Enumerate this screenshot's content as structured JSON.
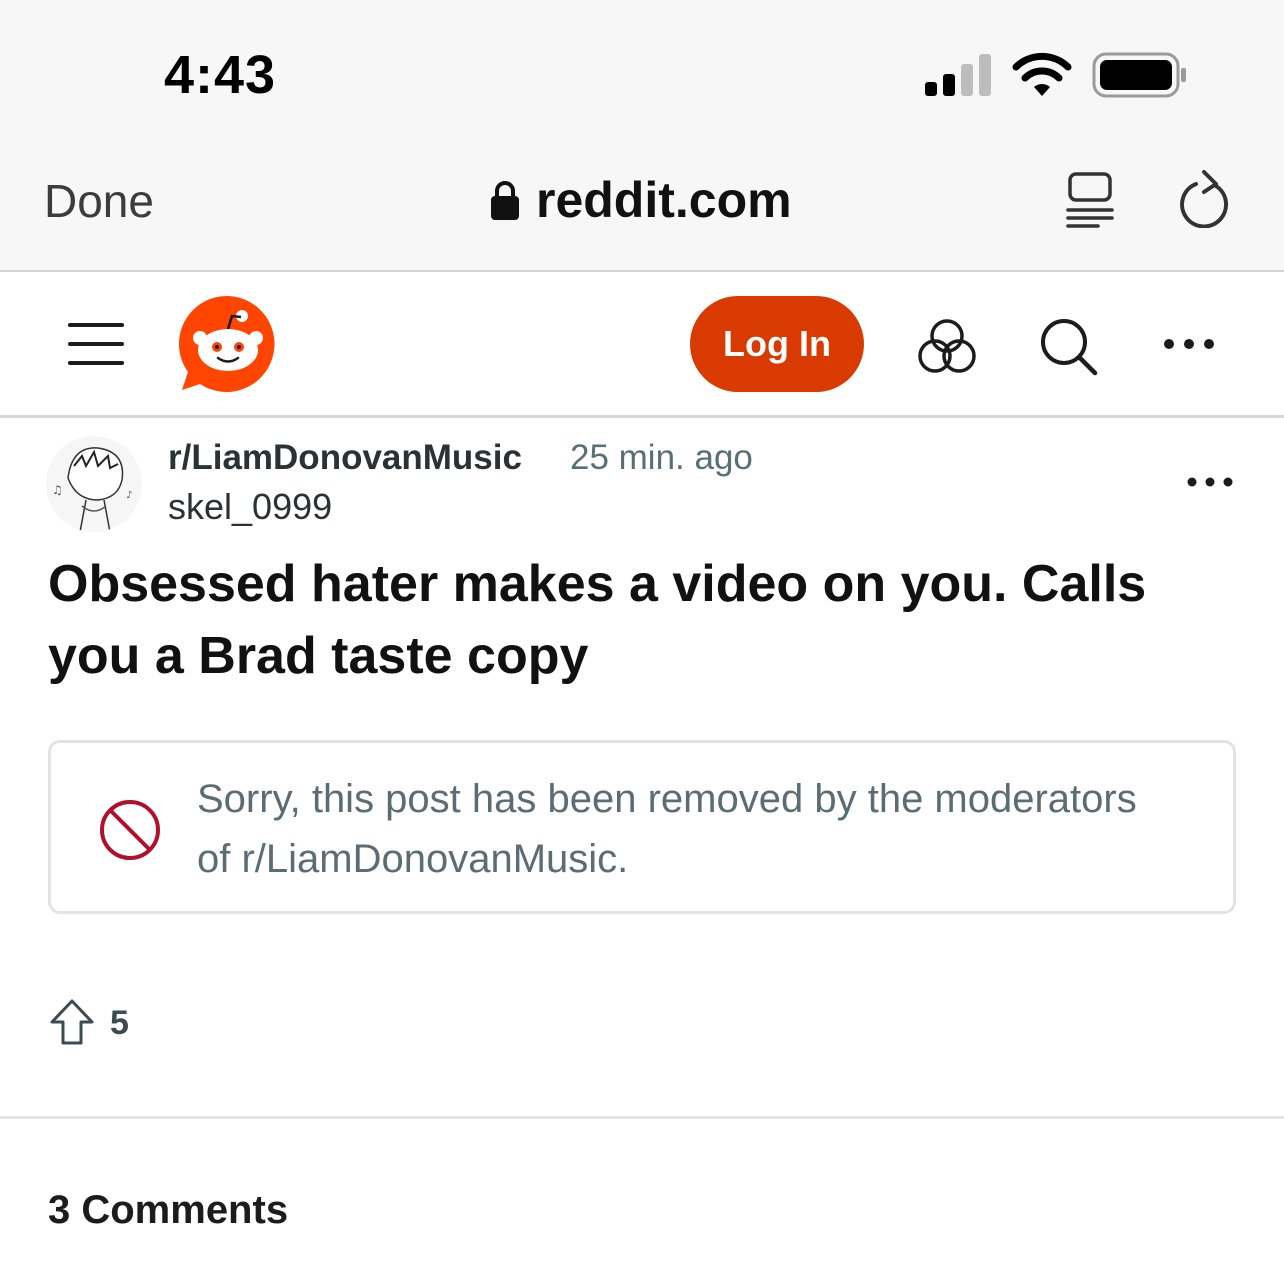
{
  "status_bar": {
    "time": "4:43"
  },
  "browser": {
    "done_label": "Done",
    "url": "reddit.com"
  },
  "header": {
    "login_label": "Log In",
    "brand_color": "#d93a00"
  },
  "post": {
    "subreddit": "r/LiamDonovanMusic",
    "time_ago": "25 min. ago",
    "author": "skel_0999",
    "title": "Obsessed hater makes a video on you. Calls you a Brad taste copy",
    "removed_message": "Sorry, this post has been removed by the moderators of r/LiamDonovanMusic.",
    "upvotes": "5"
  },
  "comments": {
    "label": "3 Comments"
  },
  "icons": [
    "signal-icon",
    "wifi-icon",
    "battery-icon",
    "lock-icon",
    "reader-icon",
    "reload-icon",
    "menu-icon",
    "reddit-logo",
    "app-icon",
    "search-icon",
    "more-icon",
    "ban-icon",
    "upvote-icon"
  ]
}
